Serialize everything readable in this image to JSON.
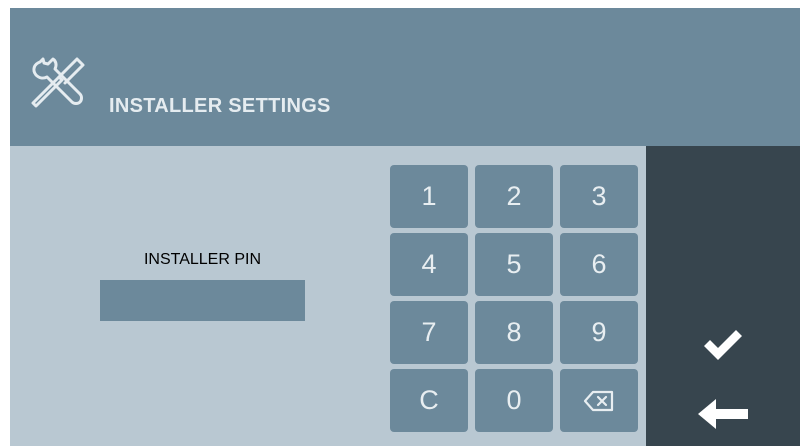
{
  "header": {
    "title": "INSTALLER SETTINGS",
    "icon": "tools-icon"
  },
  "pin": {
    "label": "INSTALLER PIN",
    "value": ""
  },
  "keypad": {
    "keys": [
      {
        "label": "1",
        "icon": null
      },
      {
        "label": "2",
        "icon": null
      },
      {
        "label": "3",
        "icon": null
      },
      {
        "label": "4",
        "icon": null
      },
      {
        "label": "5",
        "icon": null
      },
      {
        "label": "6",
        "icon": null
      },
      {
        "label": "7",
        "icon": null
      },
      {
        "label": "8",
        "icon": null
      },
      {
        "label": "9",
        "icon": null
      },
      {
        "label": "C",
        "icon": null
      },
      {
        "label": "0",
        "icon": null
      },
      {
        "label": "",
        "icon": "backspace-icon"
      }
    ]
  },
  "side_panel": {
    "confirm_icon": "checkmark-icon",
    "back_icon": "arrow-left-icon"
  },
  "colors": {
    "header_bg": "#6c899b",
    "body_bg": "#b9c8d2",
    "key_bg": "#6c899b",
    "side_panel_bg": "#37454e",
    "text_light": "#e8eef1",
    "text_dark": "#000000"
  }
}
